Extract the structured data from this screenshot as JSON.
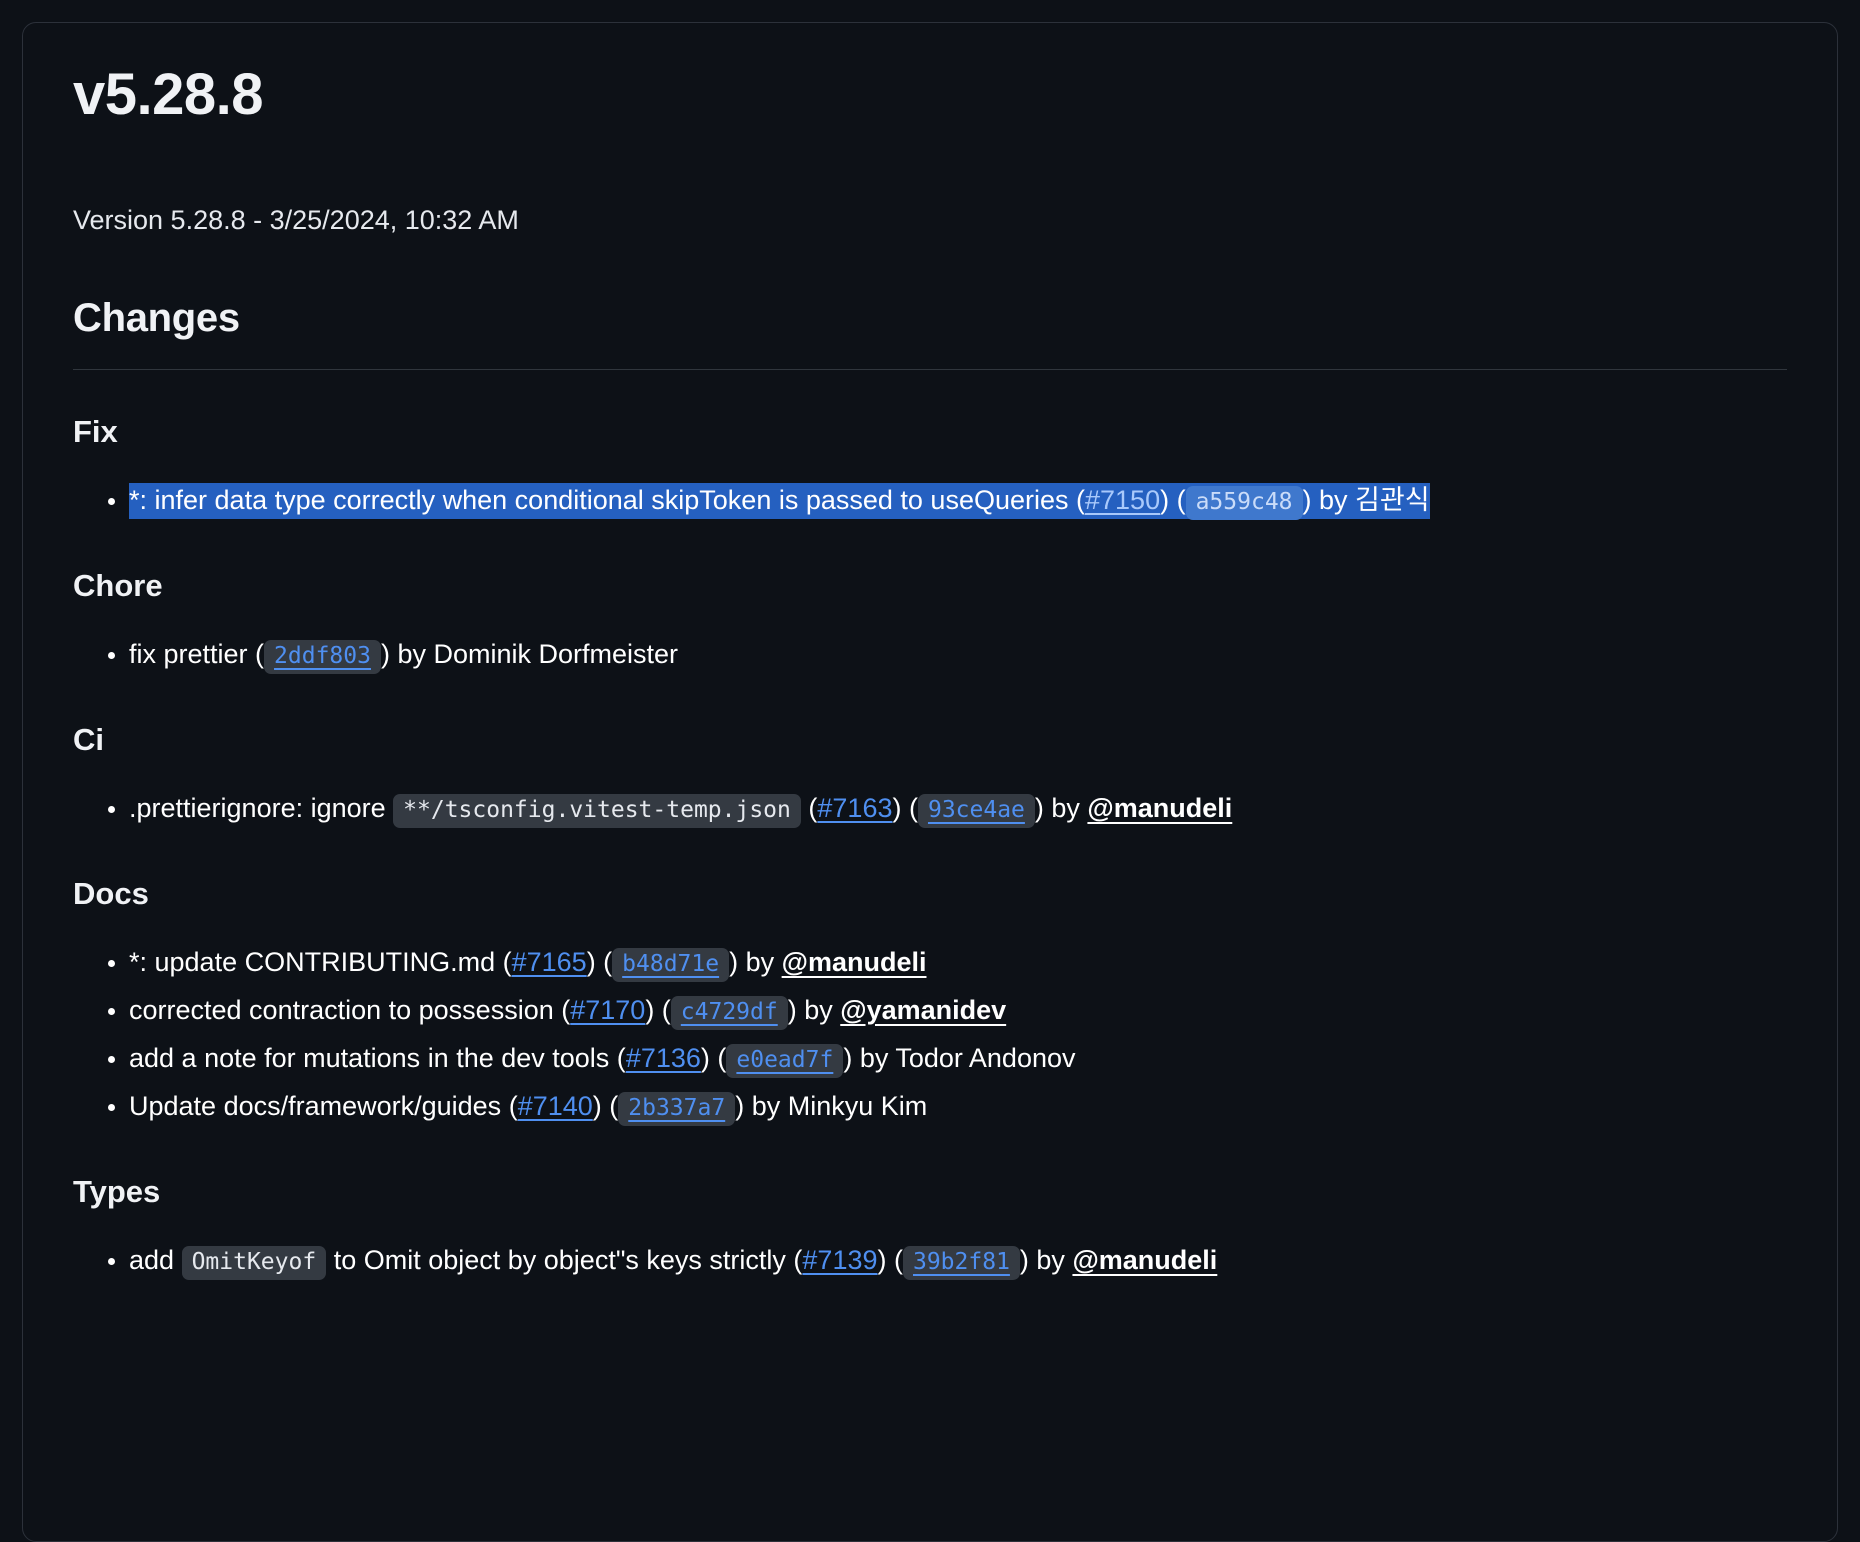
{
  "release": {
    "title": "v5.28.8",
    "version_line": "Version 5.28.8 - 3/25/2024, 10:32 AM",
    "changes_heading": "Changes"
  },
  "colors": {
    "page_background": "#0d1117",
    "card_border": "#2c313a",
    "link_blue": "#4f8ff0",
    "selection_blue": "#2560c0",
    "code_background": "#343a42",
    "rule": "#30363d",
    "text": "#ffffff"
  },
  "sections": [
    {
      "heading": "Fix",
      "entries": [
        {
          "selected": true,
          "before_text": "*: infer data type correctly when conditional skipToken is passed to useQueries (",
          "pr": "#7150",
          "mid_text": ") (",
          "hash": "a559c48",
          "after_text": ") by ",
          "author": "김관식",
          "author_is_link": false
        }
      ]
    },
    {
      "heading": "Chore",
      "entries": [
        {
          "selected": false,
          "before_text": "fix prettier (",
          "pr": null,
          "mid_text": "",
          "hash": "2ddf803",
          "after_text": ") by ",
          "author": "Dominik Dorfmeister",
          "author_is_link": false
        }
      ]
    },
    {
      "heading": "Ci",
      "entries": [
        {
          "selected": false,
          "before_text": ".prettierignore: ignore ",
          "code": "**/tsconfig.vitest-temp.json",
          "code_suffix": " (",
          "pr": "#7163",
          "mid_text": ") (",
          "hash": "93ce4ae",
          "after_text": ") by ",
          "author": "@manudeli",
          "author_is_link": true
        }
      ]
    },
    {
      "heading": "Docs",
      "entries": [
        {
          "selected": false,
          "before_text": "*: update CONTRIBUTING.md (",
          "pr": "#7165",
          "mid_text": ") (",
          "hash": "b48d71e",
          "after_text": ") by ",
          "author": "@manudeli",
          "author_is_link": true
        },
        {
          "selected": false,
          "before_text": "corrected contraction to possession (",
          "pr": "#7170",
          "mid_text": ") (",
          "hash": "c4729df",
          "after_text": ") by ",
          "author": "@yamanidev",
          "author_is_link": true
        },
        {
          "selected": false,
          "before_text": "add a note for mutations in the dev tools (",
          "pr": "#7136",
          "mid_text": ") (",
          "hash": "e0ead7f",
          "after_text": ") by ",
          "author": "Todor Andonov",
          "author_is_link": false
        },
        {
          "selected": false,
          "before_text": "Update docs/framework/guides (",
          "pr": "#7140",
          "mid_text": ") (",
          "hash": "2b337a7",
          "after_text": ") by ",
          "author": "Minkyu Kim",
          "author_is_link": false
        }
      ]
    },
    {
      "heading": "Types",
      "entries": [
        {
          "selected": false,
          "before_text": "add ",
          "code": "OmitKeyof",
          "code_suffix": " to Omit object by object\"s keys strictly (",
          "pr": "#7139",
          "mid_text": ") (",
          "hash": "39b2f81",
          "after_text": ") by ",
          "author": "@manudeli",
          "author_is_link": true
        }
      ]
    }
  ]
}
